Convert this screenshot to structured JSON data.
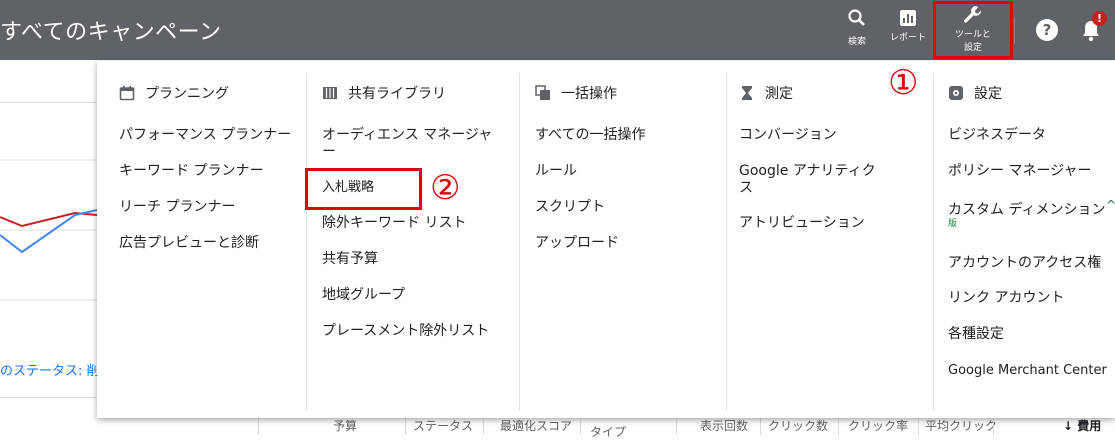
{
  "header": {
    "title": "すべてのキャンペーン",
    "search_label": "検索",
    "reports_label": "レポート",
    "tools_label_line1": "ツールと",
    "tools_label_line2": "設定",
    "help_icon": "help-icon",
    "notification_badge": "!"
  },
  "annotations": {
    "one": "①",
    "two": "②"
  },
  "menu": {
    "planning": {
      "heading": "プランニング",
      "items": [
        "パフォーマンス プランナー",
        "キーワード プランナー",
        "リーチ プランナー",
        "広告プレビューと診断"
      ]
    },
    "shared_library": {
      "heading": "共有ライブラリ",
      "items": [
        "オーディエンス マネージャ",
        "ー",
        "入札戦略",
        "除外キーワード リスト",
        "共有予算",
        "地域グループ",
        "プレースメント除外リスト"
      ]
    },
    "bulk_actions": {
      "heading": "一括操作",
      "items": [
        "すべての一括操作",
        "ルール",
        "スクリプト",
        "アップロード"
      ]
    },
    "measurement": {
      "heading": "測定",
      "items": [
        "コンバージョン",
        "Google アナリティク",
        "ス",
        "アトリビューション"
      ]
    },
    "settings": {
      "heading": "設定",
      "items": [
        "ビジネスデータ",
        "ポリシー マネージャー",
        "カスタム ディメンション",
        "版",
        "アカウントのアクセス権",
        "リンク アカウント",
        "各種設定",
        "Google Merchant Center"
      ]
    }
  },
  "background": {
    "status_text": "のステータス: 削",
    "table_headers": [
      "予算",
      "ステータス",
      "最適化スコア",
      "タイプ",
      "表示回数",
      "クリック数",
      "クリック率",
      "平均クリック",
      "↓ 費用"
    ]
  },
  "colors": {
    "topbar": "#5f6368",
    "highlight": "#e0000a",
    "series_red": "#c5221f",
    "series_blue": "#4285f4"
  }
}
